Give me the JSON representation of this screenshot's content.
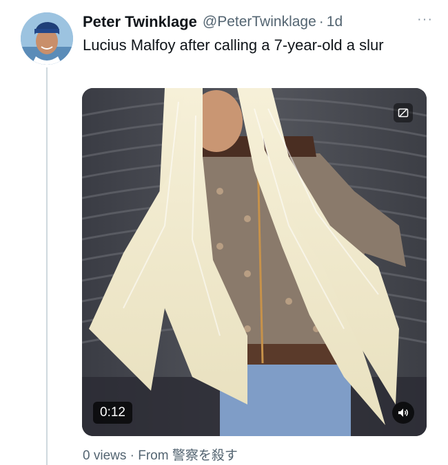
{
  "author": {
    "name": "Peter Twinklage",
    "handle": "@PeterTwinklage",
    "separator": "·",
    "time": "1d"
  },
  "tweet": {
    "text": "Lucius Malfoy after calling a 7-year-old a slur"
  },
  "media": {
    "duration": "0:12",
    "badge_icon": "gif-icon",
    "volume_icon": "speaker-icon"
  },
  "footer": {
    "views": "0 views",
    "separator": "·",
    "from_label": "From",
    "source": "警察を殺す"
  },
  "more_icon": "more-icon"
}
